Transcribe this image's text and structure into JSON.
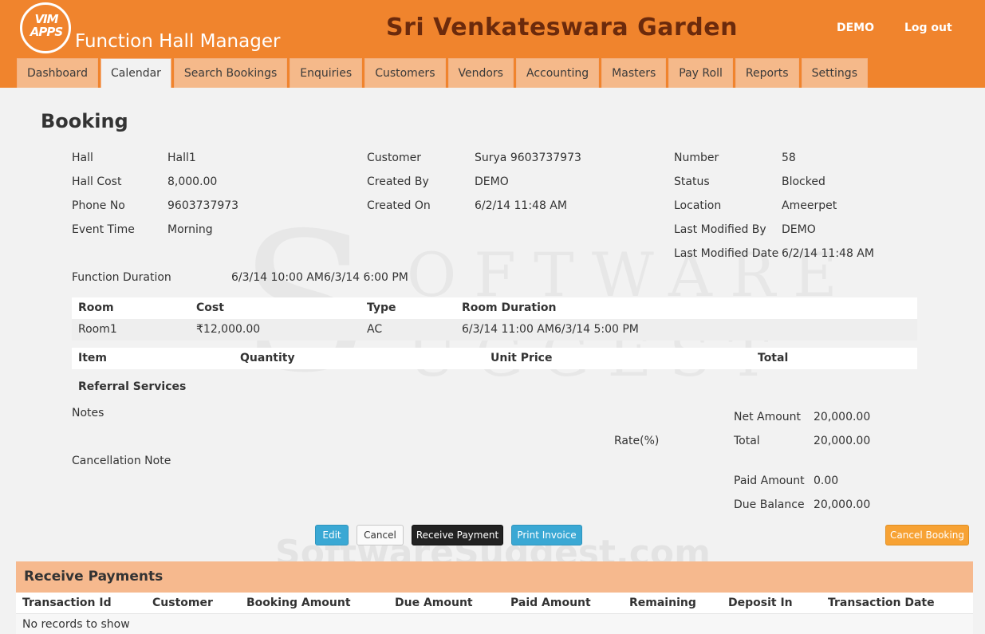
{
  "header": {
    "logo_text": "VIM APPS",
    "app_name": "Function Hall Manager",
    "org_name": "Sri Venkateswara Garden",
    "user": "DEMO",
    "logout": "Log out"
  },
  "tabs": [
    {
      "label": "Dashboard"
    },
    {
      "label": "Calendar",
      "active": true
    },
    {
      "label": "Search Bookings"
    },
    {
      "label": "Enquiries"
    },
    {
      "label": "Customers"
    },
    {
      "label": "Vendors"
    },
    {
      "label": "Accounting"
    },
    {
      "label": "Masters"
    },
    {
      "label": "Pay Roll"
    },
    {
      "label": "Reports"
    },
    {
      "label": "Settings"
    }
  ],
  "page_title": "Booking",
  "details": {
    "col1": [
      {
        "label": "Hall",
        "value": "Hall1"
      },
      {
        "label": "Hall Cost",
        "value": "8,000.00"
      },
      {
        "label": "Phone No",
        "value": "9603737973"
      },
      {
        "label": "Event Time",
        "value": "Morning"
      }
    ],
    "col2": [
      {
        "label": "Customer",
        "value": "Surya 9603737973"
      },
      {
        "label": "Created By",
        "value": "DEMO"
      },
      {
        "label": "Created On",
        "value": "6/2/14 11:48 AM"
      }
    ],
    "col3": [
      {
        "label": "Number",
        "value": "58"
      },
      {
        "label": "Status",
        "value": "Blocked"
      },
      {
        "label": "Location",
        "value": "Ameerpet"
      },
      {
        "label": "Last Modified By",
        "value": "DEMO"
      },
      {
        "label": "Last Modified Date",
        "value": "6/2/14 11:48 AM"
      }
    ],
    "function_duration": {
      "label": "Function Duration",
      "value": "6/3/14 10:00 AM6/3/14 6:00 PM"
    }
  },
  "rooms_table": {
    "headers": [
      "Room",
      "Cost",
      "Type",
      "Room Duration"
    ],
    "rows": [
      [
        "Room1",
        "₹12,000.00",
        "AC",
        "6/3/14 11:00 AM6/3/14 5:00 PM"
      ]
    ]
  },
  "items_table": {
    "headers": [
      "Item",
      "Quantity",
      "Unit Price",
      "Total"
    ]
  },
  "referral_label": "Referral Services",
  "notes_label": "Notes",
  "cancellation_note_label": "Cancellation Note",
  "rate_label": "Rate(%)",
  "summary": {
    "net_amount": {
      "label": "Net Amount",
      "value": "20,000.00"
    },
    "total": {
      "label": "Total",
      "value": "20,000.00"
    },
    "paid_amount": {
      "label": "Paid Amount",
      "value": "0.00"
    },
    "due_balance": {
      "label": "Due Balance",
      "value": "20,000.00"
    }
  },
  "buttons": {
    "edit": "Edit",
    "cancel": "Cancel",
    "receive_payment": "Receive Payment",
    "print_invoice": "Print Invoice",
    "cancel_booking": "Cancel Booking"
  },
  "watermark": {
    "letter": "S",
    "top": "OFTWARE",
    "bottom": "UGGEST",
    "footer": "SoftwareSuggest.com"
  },
  "receive_payments": {
    "title": "Receive Payments",
    "headers": [
      "Transaction Id",
      "Customer",
      "Booking Amount",
      "Due Amount",
      "Paid Amount",
      "Remaining",
      "Deposit In",
      "Transaction Date"
    ],
    "empty_text": "No records to show"
  }
}
